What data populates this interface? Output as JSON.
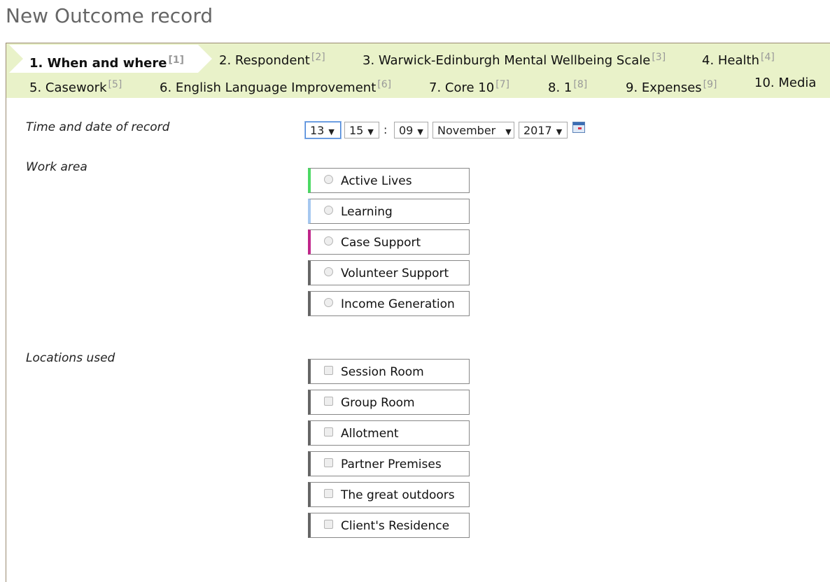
{
  "page": {
    "title": "New Outcome record"
  },
  "tabs": [
    {
      "label": "1. When and where",
      "num": "[1]"
    },
    {
      "label": "2. Respondent",
      "num": "[2]"
    },
    {
      "label": "3. Warwick-Edinburgh Mental Wellbeing Scale",
      "num": "[3]"
    },
    {
      "label": "4. Health",
      "num": "[4]"
    },
    {
      "label": "5. Casework",
      "num": "[5]"
    },
    {
      "label": "6. English Language Improvement",
      "num": "[6]"
    },
    {
      "label": "7. Core 10",
      "num": "[7]"
    },
    {
      "label": "8. 1",
      "num": "[8]"
    },
    {
      "label": "9. Expenses",
      "num": "[9]"
    },
    {
      "label": "10. Media",
      "num": ""
    }
  ],
  "time_date": {
    "label": "Time and date of record",
    "hour": "13",
    "minute": "15",
    "separator": ":",
    "day": "09",
    "month": "November",
    "year": "2017",
    "arrow": "▼",
    "calendar_icon": "calendar-icon"
  },
  "work_area": {
    "label": "Work area",
    "options": [
      {
        "label": "Active Lives",
        "accent": "#4cd964"
      },
      {
        "label": "Learning",
        "accent": "#a6c8f0"
      },
      {
        "label": "Case Support",
        "accent": "#c0268a"
      },
      {
        "label": "Volunteer Support",
        "accent": "#666666"
      },
      {
        "label": "Income Generation",
        "accent": "#666666"
      }
    ]
  },
  "locations": {
    "label": "Locations used",
    "options": [
      {
        "label": "Session Room"
      },
      {
        "label": "Group Room"
      },
      {
        "label": "Allotment"
      },
      {
        "label": "Partner Premises"
      },
      {
        "label": "The great outdoors"
      },
      {
        "label": "Client's Residence"
      }
    ]
  }
}
